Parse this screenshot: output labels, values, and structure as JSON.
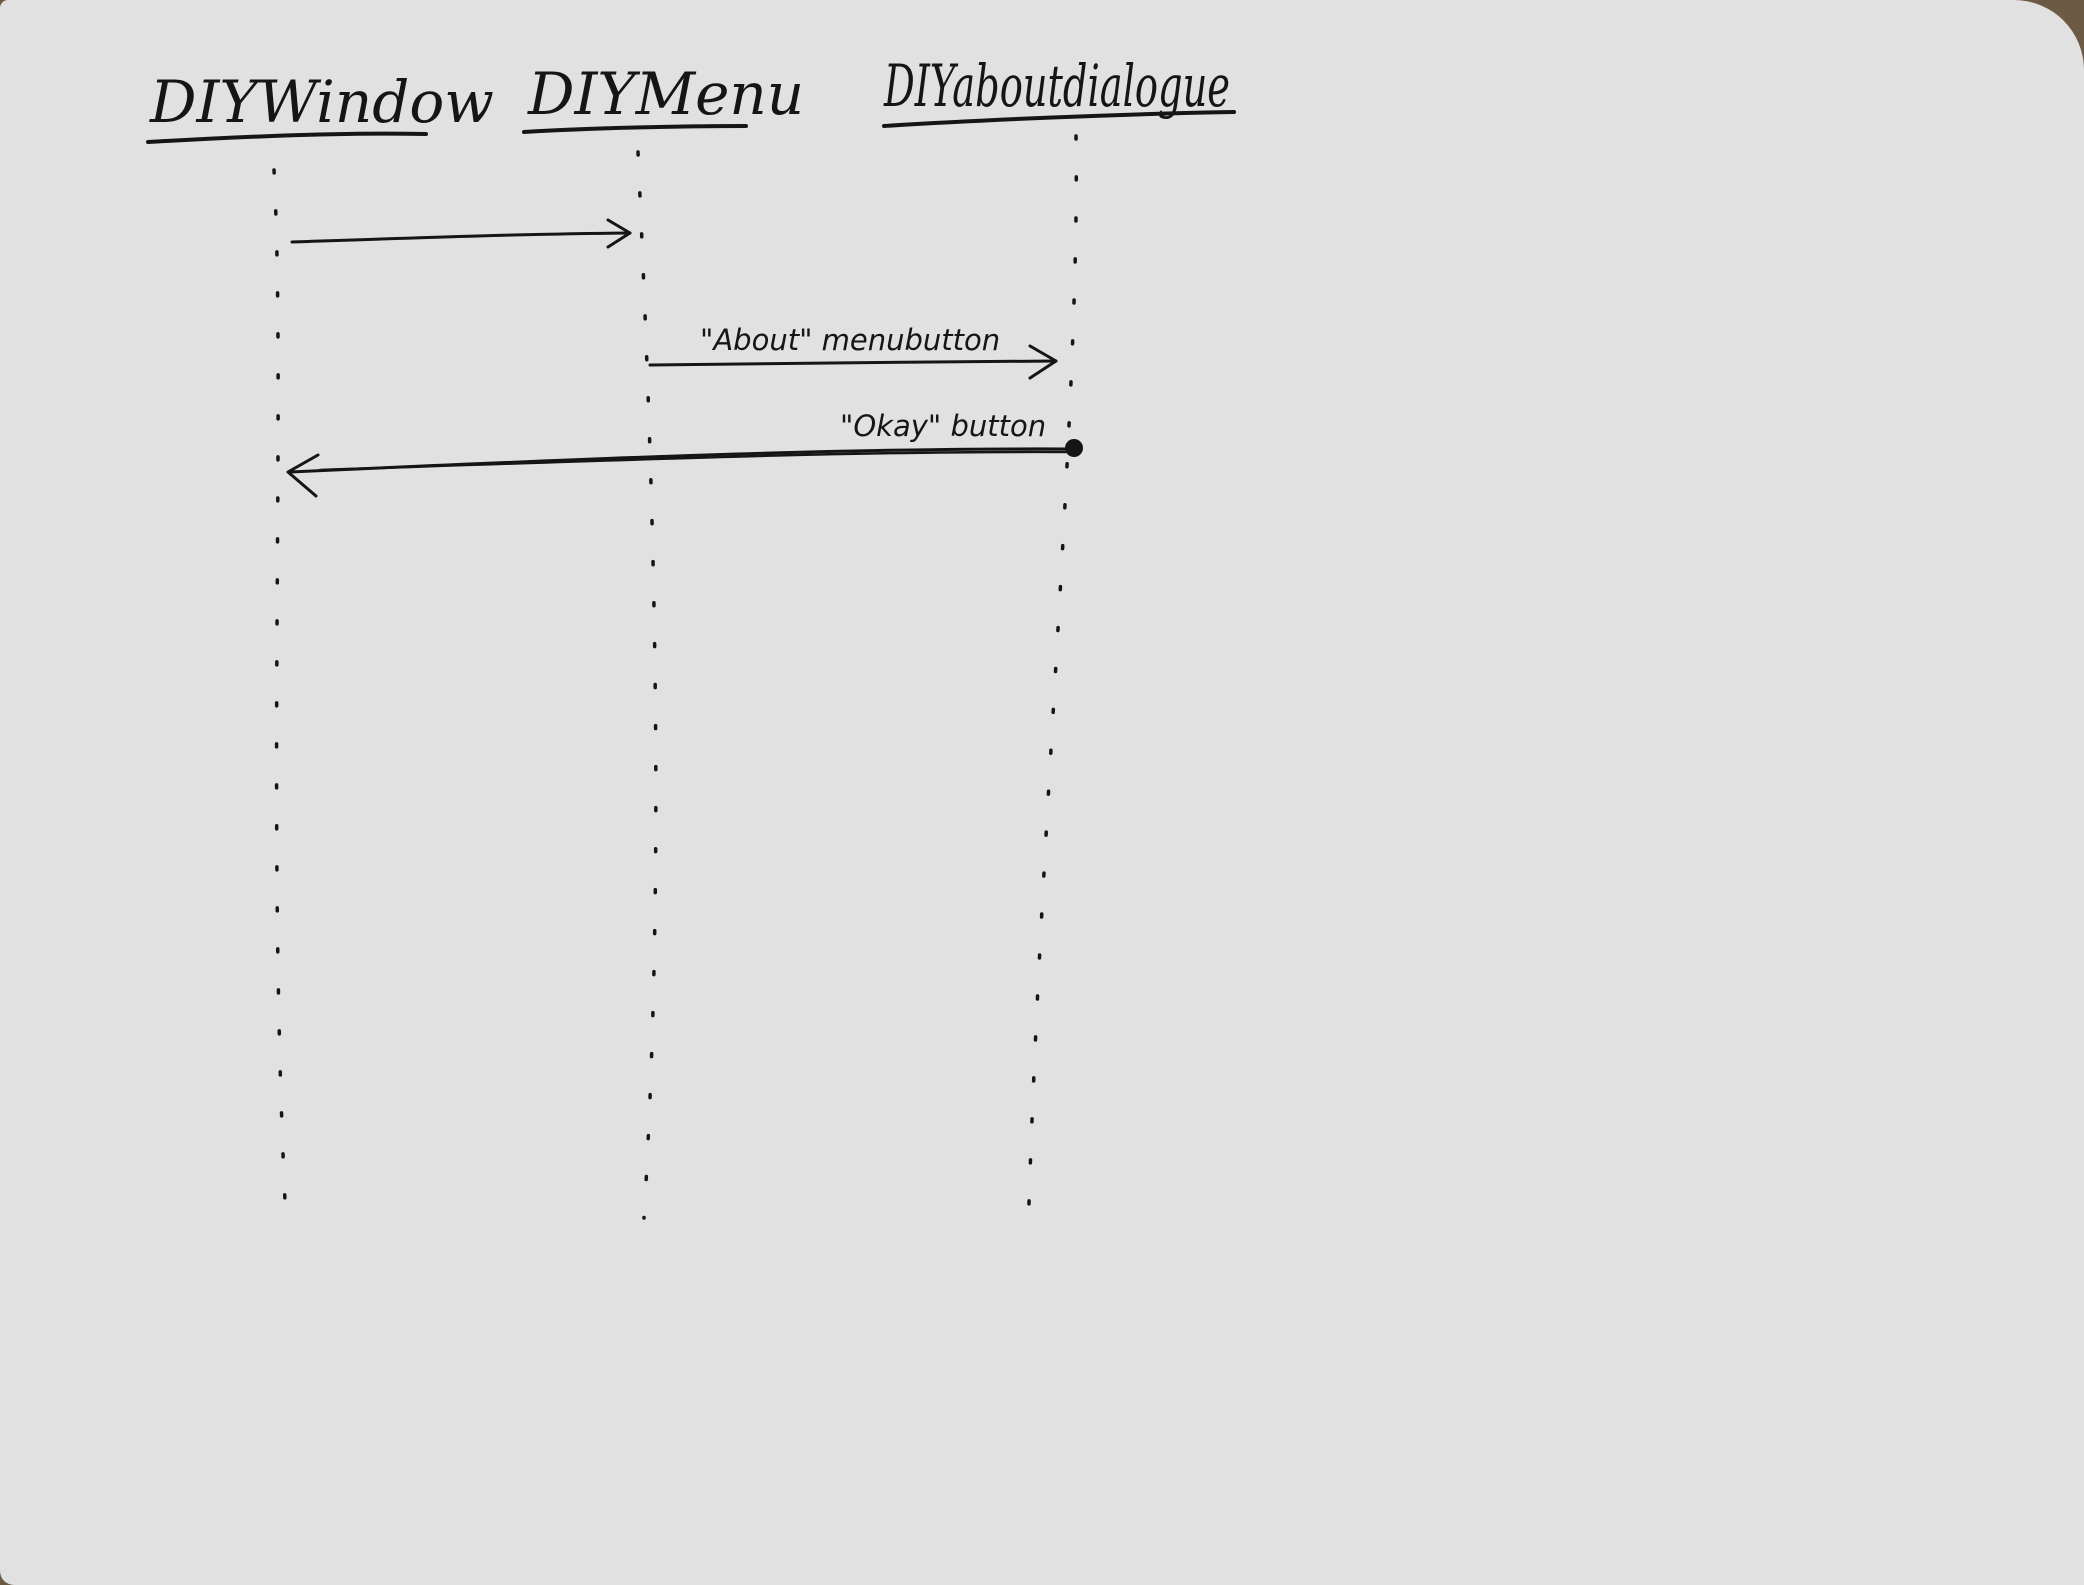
{
  "diagram": {
    "type": "sequence",
    "lifelines": [
      {
        "id": "diy-window",
        "label": "DIYWindow"
      },
      {
        "id": "diy-menu",
        "label": "DIYMenu"
      },
      {
        "id": "diy-about-dialogue",
        "label": "DIYaboutdialogue"
      }
    ],
    "messages": [
      {
        "from": "diy-window",
        "to": "diy-menu",
        "label": "",
        "arrow": "open"
      },
      {
        "from": "diy-menu",
        "to": "diy-about-dialogue",
        "label": "\"About\" menubutton",
        "arrow": "open"
      },
      {
        "from": "diy-about-dialogue",
        "to": "diy-window",
        "label": "\"Okay\" button",
        "arrow": "open",
        "start": "filled-dot"
      }
    ]
  },
  "colors": {
    "paper": "#e1e1e1",
    "ink": "#151515",
    "board_edge": "#6b5a44"
  }
}
